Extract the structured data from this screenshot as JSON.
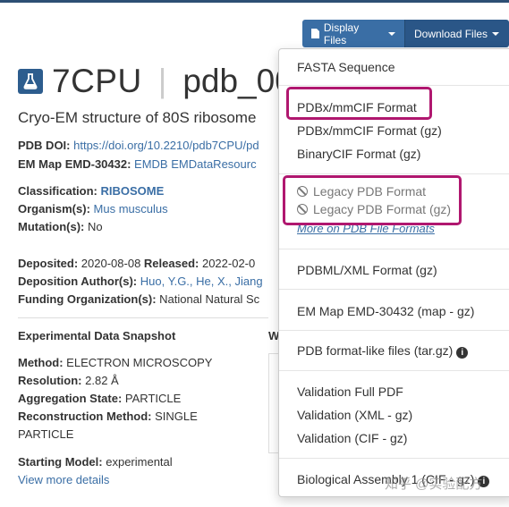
{
  "toolbar": {
    "display_label": "Display Files",
    "download_label": "Download Files"
  },
  "entry": {
    "id": "7CPU",
    "separator": "|",
    "pdb_id": "pdb_00",
    "subtitle": "Cryo-EM structure of 80S ribosome"
  },
  "info": {
    "doi_label": "PDB DOI:",
    "doi_value": "https://doi.org/10.2210/pdb7CPU/pd",
    "emmap_label": "EM Map EMD-30432:",
    "emmap_value": "EMDB EMDataResourc",
    "classification_label": "Classification:",
    "classification_value": "RIBOSOME",
    "organism_label": "Organism(s):",
    "organism_value": "Mus musculus",
    "mutation_label": "Mutation(s):",
    "mutation_value": "No",
    "deposited_label": "Deposited:",
    "deposited_value": "2020-08-08",
    "released_label": "Released:",
    "released_value": "2022-02-0",
    "authors_label": "Deposition Author(s):",
    "authors_value": "Huo, Y.G., He, X., Jiang",
    "funding_label": "Funding Organization(s):",
    "funding_value": "National Natural Sc"
  },
  "snapshot": {
    "title": "Experimental Data Snapshot",
    "side_letter": "W",
    "method_label": "Method:",
    "method_value": "ELECTRON MICROSCOPY",
    "resolution_label": "Resolution:",
    "resolution_value": "2.82 Å",
    "aggregation_label": "Aggregation State:",
    "aggregation_value": "PARTICLE",
    "reconstruction_label": "Reconstruction Method:",
    "reconstruction_value": "SINGLE",
    "reconstruction_value2": "PARTICLE",
    "starting_label": "Starting Model:",
    "starting_value": "experimental",
    "view_more": "View more details"
  },
  "menu": {
    "fasta": "FASTA Sequence",
    "mmcif": "PDBx/mmCIF Format",
    "mmcif_gz": "PDBx/mmCIF Format (gz)",
    "bcif": "BinaryCIF Format (gz)",
    "legacy": "Legacy PDB Format",
    "legacy_gz": "Legacy PDB Format (gz)",
    "more": "More on PDB File Formats",
    "pdbml": "PDBML/XML Format (gz)",
    "emmap": "EM Map EMD-30432 (map - gz)",
    "pdblike": "PDB format-like files (tar.gz)",
    "val_pdf": "Validation Full PDF",
    "val_xml": "Validation (XML - gz)",
    "val_cif": "Validation (CIF - gz)",
    "bio_assembly": "Biological Assembly 1 (CIF - gz)"
  },
  "watermark": "知乎 @实验配方",
  "colors": {
    "accent": "#3a6ea5",
    "highlight": "#b0176f"
  }
}
